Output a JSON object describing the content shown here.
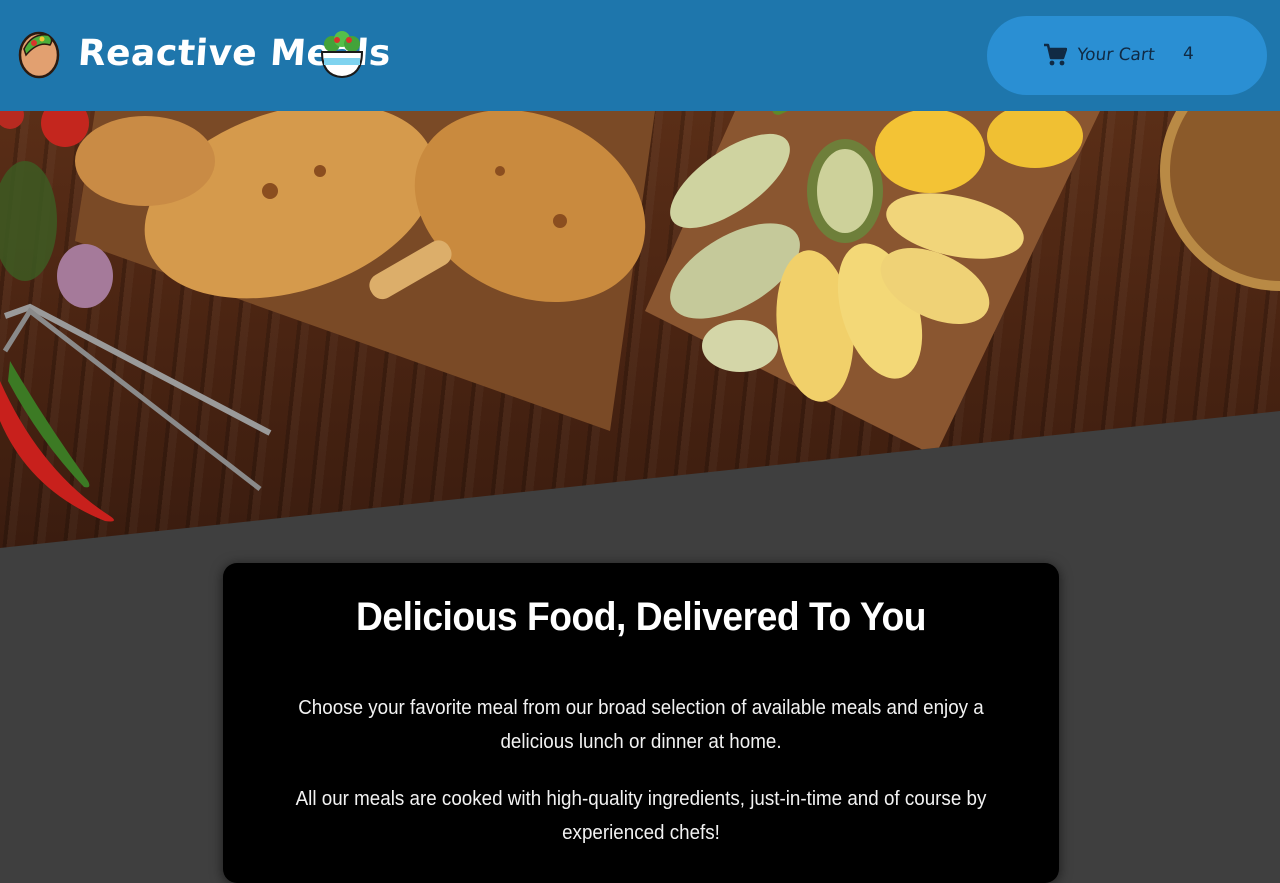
{
  "header": {
    "brand": "Reactive Meals",
    "logo_left_icon": "taco-icon",
    "logo_right_icon": "salad-bowl-icon",
    "background": "#1e76ac"
  },
  "cart": {
    "icon": "shopping-cart-icon",
    "label": "Your Cart",
    "count": "4",
    "button_color": "#2a8fd3"
  },
  "hero": {
    "image_description_icon": "grilled-chicken-and-vegetables-image"
  },
  "summary": {
    "title": "Delicious Food, Delivered To You",
    "paragraph_1": "Choose your favorite meal from our broad selection of available meals and enjoy a delicious lunch or dinner at home.",
    "paragraph_2": "All our meals are cooked with high-quality ingredients, just-in-time and of course by experienced chefs!"
  }
}
